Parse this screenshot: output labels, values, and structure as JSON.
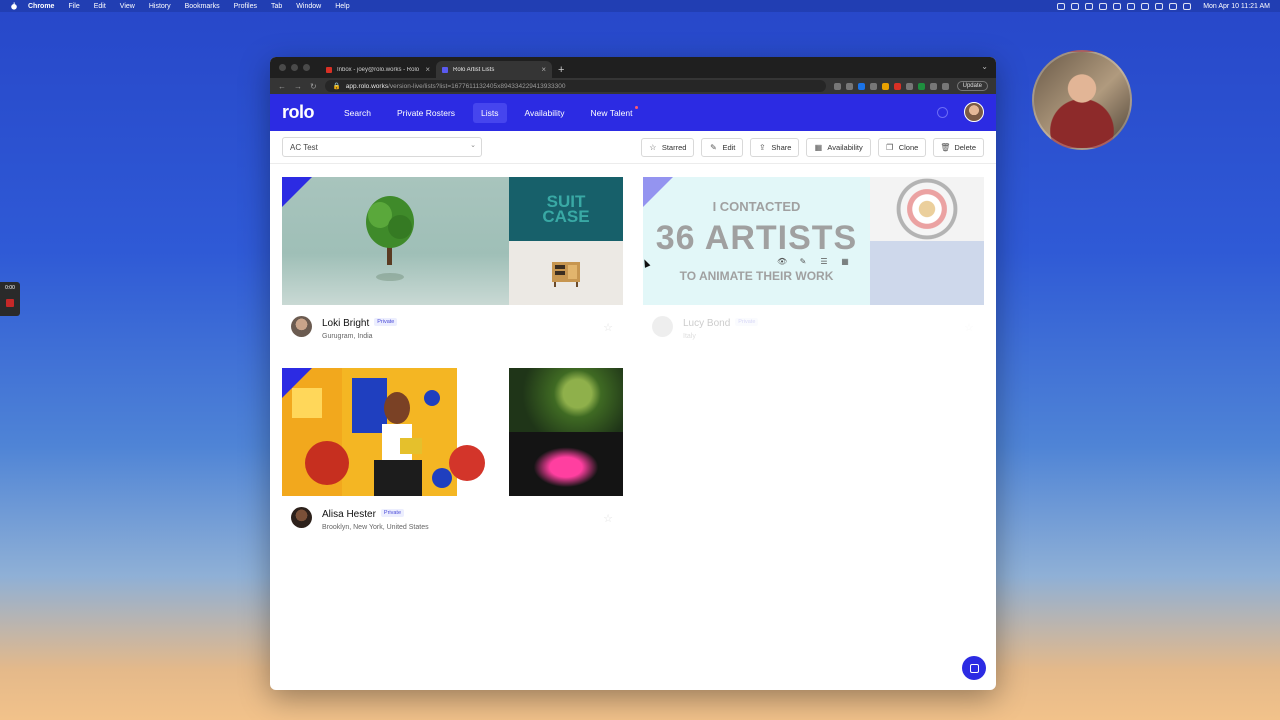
{
  "menubar": {
    "app": "Chrome",
    "items": [
      "File",
      "Edit",
      "View",
      "History",
      "Bookmarks",
      "Profiles",
      "Tab",
      "Window",
      "Help"
    ],
    "clock": "Mon Apr 10  11:21 AM"
  },
  "recorder": {
    "time": "0:00"
  },
  "browser": {
    "tabs": [
      {
        "title": "Inbox - joey@rolo.works - Rolo",
        "favicon_color": "#d93025"
      },
      {
        "title": "Rolo Artist Lists",
        "favicon_color": "#2c2be3"
      }
    ],
    "url_host": "app.rolo.works",
    "url_path": "/version-live/lists?list=1677611132405x894334229413933300",
    "update_label": "Update"
  },
  "app": {
    "logo": "rolo",
    "nav": [
      {
        "label": "Search"
      },
      {
        "label": "Private Rosters"
      },
      {
        "label": "Lists"
      },
      {
        "label": "Availability"
      },
      {
        "label": "New Talent"
      }
    ],
    "active_nav": "Lists",
    "accent": "#2c2be3"
  },
  "list_bar": {
    "selected_list": "AC Test",
    "actions": [
      {
        "label": "Starred",
        "icon": "star-icon"
      },
      {
        "label": "Edit",
        "icon": "pencil-icon"
      },
      {
        "label": "Share",
        "icon": "share-icon"
      },
      {
        "label": "Availability",
        "icon": "calendar-icon"
      },
      {
        "label": "Clone",
        "icon": "copy-icon"
      },
      {
        "label": "Delete",
        "icon": "trash-icon"
      }
    ]
  },
  "cards": [
    {
      "name": "Loki Bright",
      "badge": "Private",
      "location": "Gurugram, India",
      "side_text": "SUIT CASE"
    },
    {
      "name": "Lucy Bond",
      "badge": "Private",
      "location": "Italy",
      "main_line1": "I CONTACTED",
      "main_line2": "36 ARTISTS",
      "main_line3": "TO ANIMATE THEIR WORK"
    },
    {
      "name": "Alisa Hester",
      "badge": "Private",
      "location": "Brooklyn, New York, United States"
    }
  ]
}
